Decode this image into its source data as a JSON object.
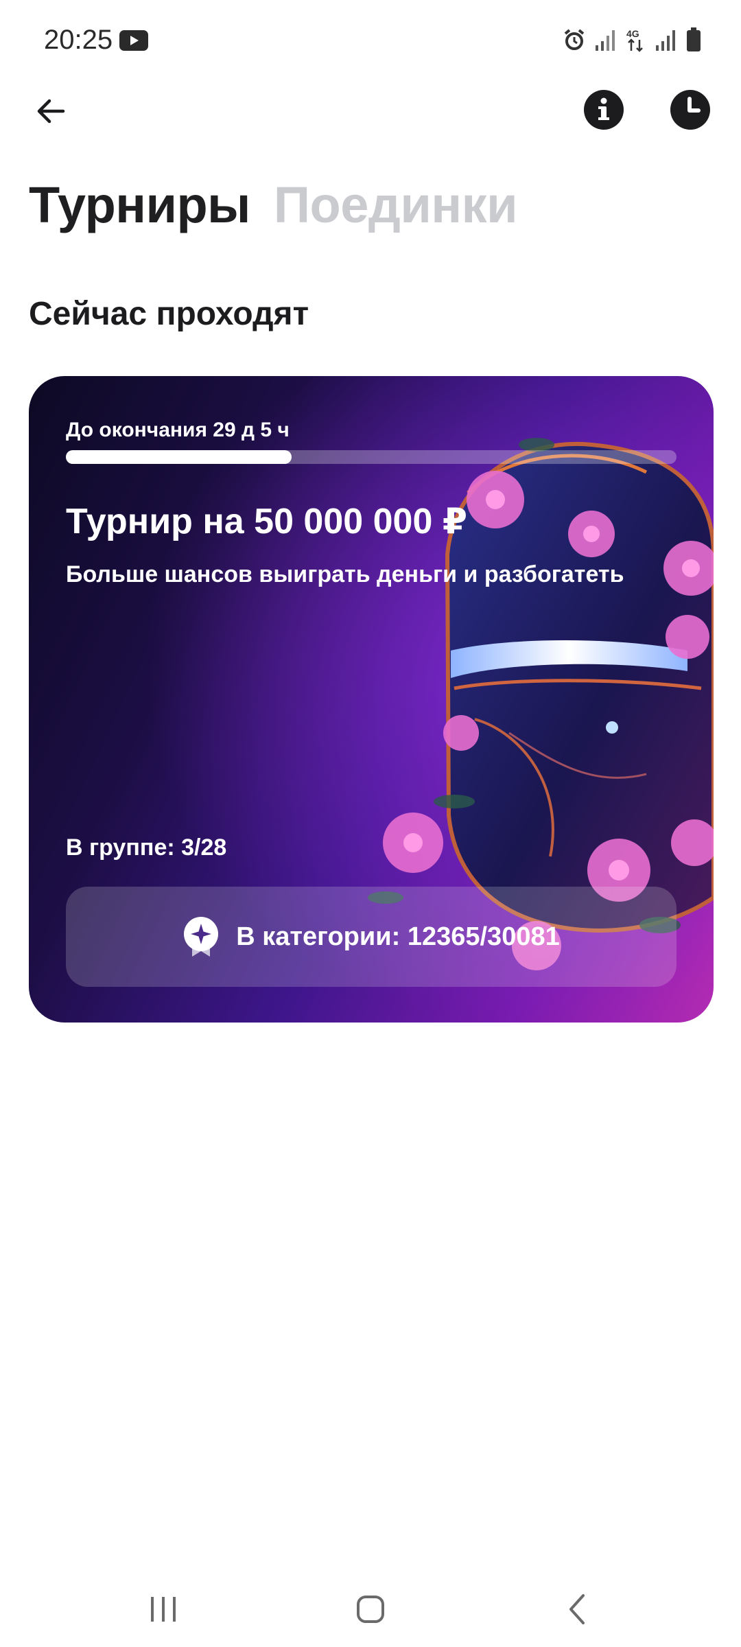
{
  "status_bar": {
    "time": "20:25",
    "network_label": "4G",
    "icons": [
      "youtube-icon",
      "alarm-icon",
      "signal-icon",
      "4g-icon",
      "signal-icon",
      "battery-icon"
    ]
  },
  "header": {
    "icons": [
      "back-arrow-icon",
      "info-icon",
      "clock-icon"
    ]
  },
  "tabs": [
    {
      "label": "Турниры",
      "active": true
    },
    {
      "label": "Поединки",
      "active": false
    }
  ],
  "section_title": "Сейчас проходят",
  "tournament_card": {
    "timer": "До окончания 29 д 5 ч",
    "progress_fraction": 0.37,
    "title": "Турнир на 50 000 000 ₽",
    "subtitle": "Больше шансов выиграть деньги и разбогатеть",
    "group": "В группе: 3/28",
    "category": "В категории: 12365/30081",
    "category_icon": "star-badge-icon"
  },
  "nav_bar": {
    "icons": [
      "recents-icon",
      "home-icon",
      "back-icon"
    ]
  },
  "colors": {
    "tab_active": "#1f1f22",
    "tab_inactive": "#c9cbcf",
    "card_gradient_start": "#0d0a24",
    "card_gradient_end": "#b42bb3"
  }
}
